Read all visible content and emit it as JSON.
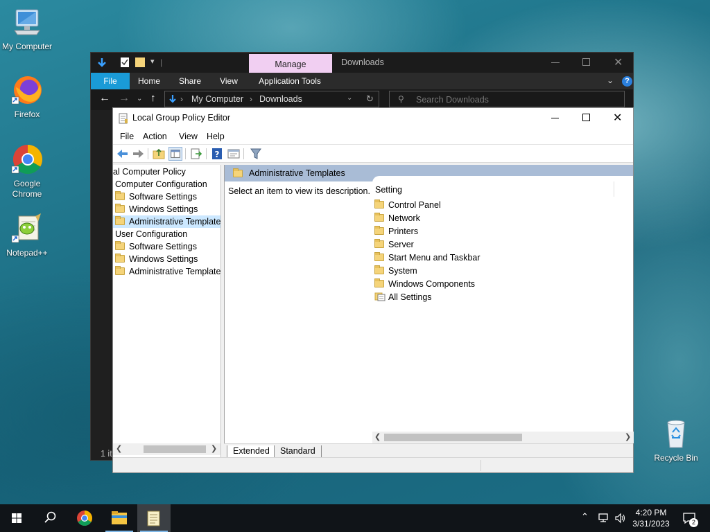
{
  "desktop": {
    "icons": [
      {
        "label": "My Computer"
      },
      {
        "label": "Firefox"
      },
      {
        "label": "Google Chrome"
      },
      {
        "label": "Notepad++"
      },
      {
        "label": "Recycle Bin"
      }
    ]
  },
  "explorer": {
    "contextual_tab": "Manage",
    "title": "Downloads",
    "tabs": [
      "File",
      "Home",
      "Share",
      "View",
      "Application Tools"
    ],
    "breadcrumb": [
      "My Computer",
      "Downloads"
    ],
    "search_placeholder": "Search Downloads",
    "status_partial": "1 it"
  },
  "gpedit": {
    "title": "Local Group Policy Editor",
    "menu": [
      "File",
      "Action",
      "View",
      "Help"
    ],
    "tree": [
      {
        "label": "Local Computer Policy",
        "display": "al Computer Policy"
      },
      {
        "label": "Computer Configuration"
      },
      {
        "label": "Software Settings"
      },
      {
        "label": "Windows Settings"
      },
      {
        "label": "Administrative Templates"
      },
      {
        "label": "User Configuration"
      },
      {
        "label": "Software Settings"
      },
      {
        "label": "Windows Settings"
      },
      {
        "label": "Administrative Templates"
      }
    ],
    "header_title": "Administrative Templates",
    "description": "Select an item to view its description.",
    "column_header": "Setting",
    "items": [
      "Control Panel",
      "Network",
      "Printers",
      "Server",
      "Start Menu and Taskbar",
      "System",
      "Windows Components",
      "All Settings"
    ],
    "sheet_tabs": [
      "Extended",
      "Standard"
    ]
  },
  "taskbar": {
    "time": "4:20 PM",
    "date": "3/31/2023",
    "notification_count": "2"
  },
  "colors": {
    "tree_selection": "#cce8ff",
    "header_band": "#a9bcd6",
    "manage_tab": "#f1cff2",
    "ribbon_file": "#1a9bd7"
  }
}
